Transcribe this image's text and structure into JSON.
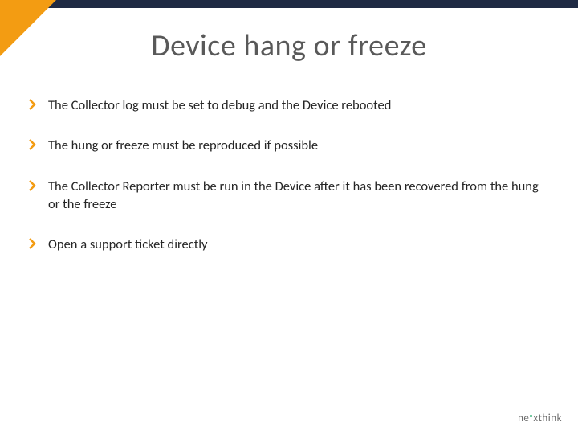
{
  "title": "Device hang or freeze",
  "bullets": [
    "The Collector log must be set to debug and the Device rebooted",
    "The hung or freeze must be reproduced if possible",
    "The Collector Reporter must be run in the Device after it has been recovered from the hung or the freeze",
    "Open a support ticket directly"
  ],
  "brand": {
    "part1": "ne",
    "part2": "x",
    "part3": "think"
  },
  "colors": {
    "accent": "#f39c12",
    "bar": "#1f2a44",
    "bullet": "#f39c12"
  }
}
